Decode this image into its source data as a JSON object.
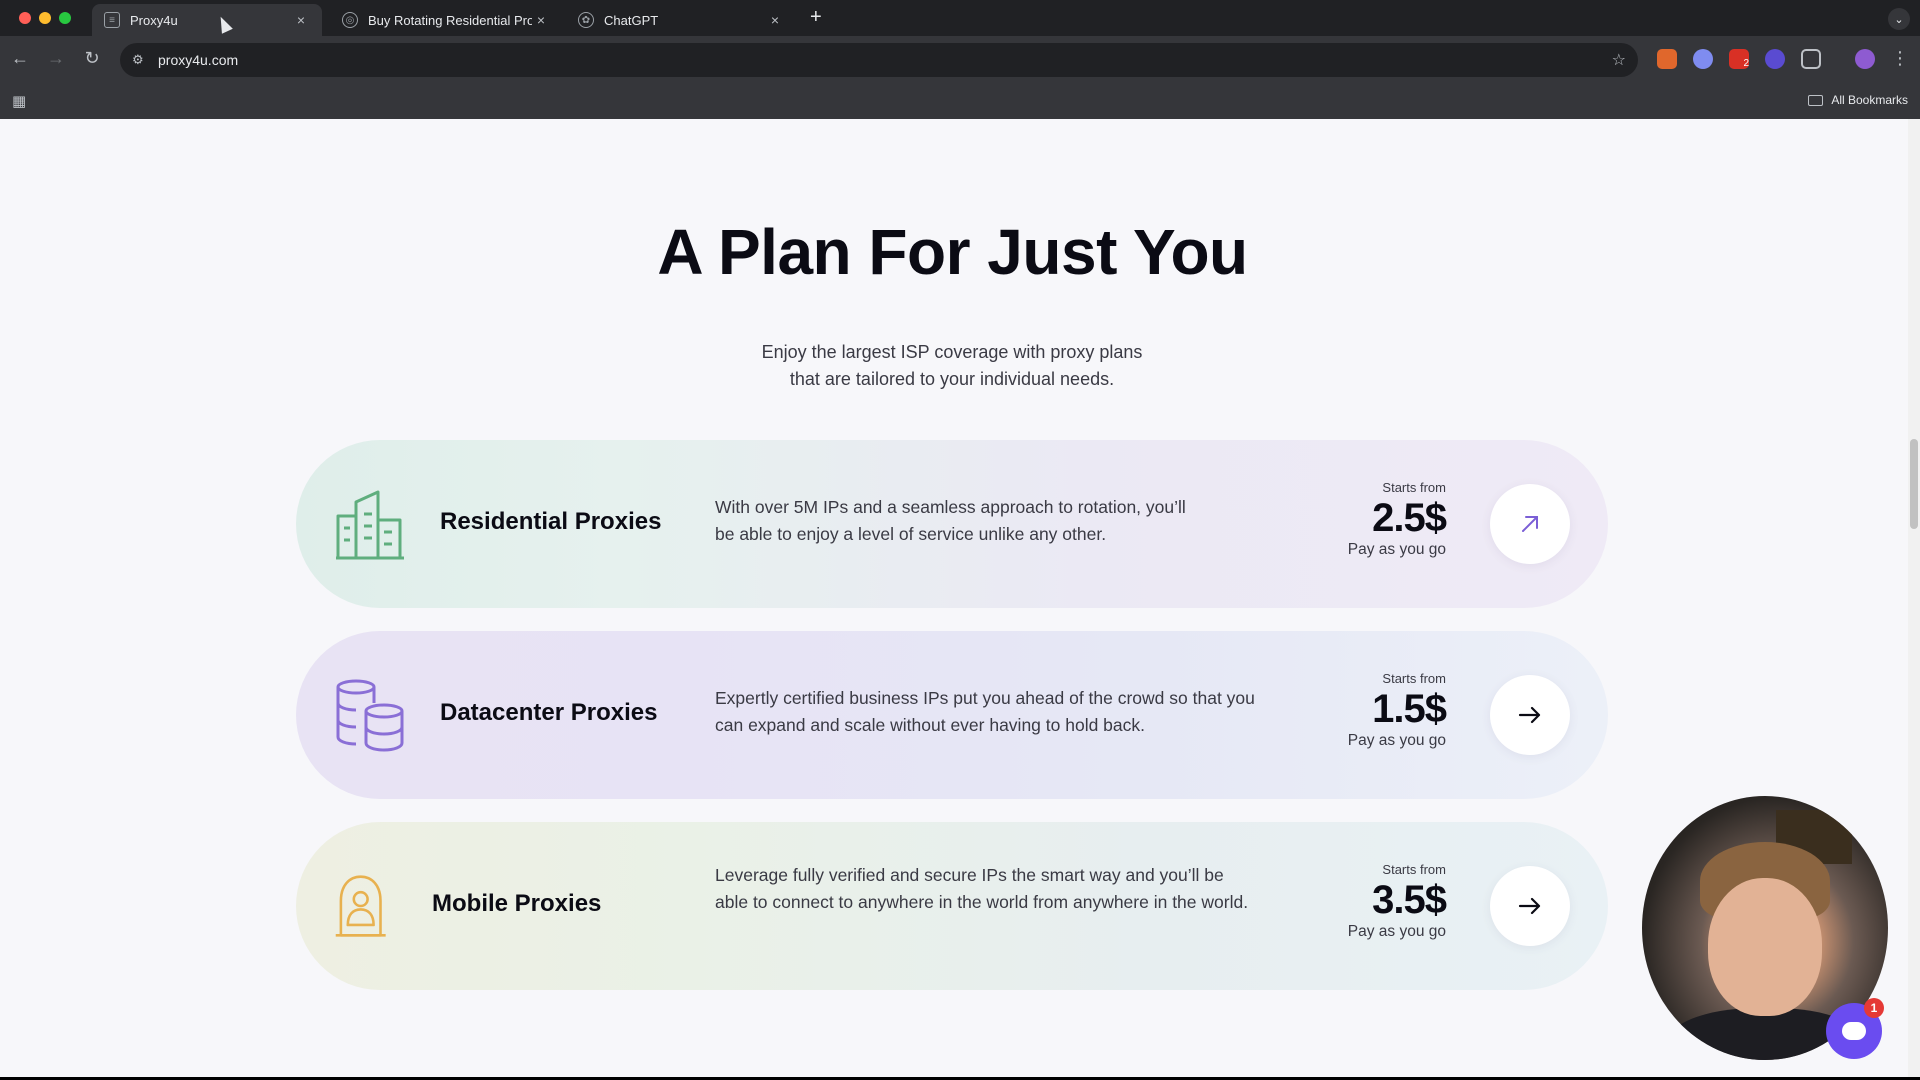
{
  "browser": {
    "tabs": [
      {
        "title": "Proxy4u",
        "active": true,
        "favicon": "proxy4u-favicon"
      },
      {
        "title": "Buy Rotating Residential Pro",
        "active": false,
        "favicon": "spiral-favicon"
      },
      {
        "title": "ChatGPT",
        "active": false,
        "favicon": "chatgpt-favicon"
      }
    ],
    "new_tab": "+",
    "close": "×",
    "url": "proxy4u.com",
    "bookmarks_label": "All Bookmarks",
    "extension_badge": "2"
  },
  "page": {
    "heading": "A Plan For Just You",
    "subtitle_line1": "Enjoy the largest ISP coverage with proxy plans",
    "subtitle_line2": "that are tailored to your individual needs.",
    "plans": [
      {
        "name": "Residential Proxies",
        "icon": "building-icon",
        "description": "With over 5M IPs and a seamless approach to rotation, you’ll be able to enjoy a level of service unlike any other.",
        "starts_from": "Starts from",
        "price": "2.5$",
        "billing": "Pay as you go",
        "arrow": "↗"
      },
      {
        "name": "Datacenter Proxies",
        "icon": "database-icon",
        "description": "Expertly certified business IPs put you ahead of the crowd so that you can expand and scale without ever having to hold back.",
        "starts_from": "Starts from",
        "price": "1.5$",
        "billing": "Pay as you go",
        "arrow": "→"
      },
      {
        "name": "Mobile Proxies",
        "icon": "mobile-lock-icon",
        "description": "Leverage fully verified and secure IPs the smart way and you’ll be able to connect to anywhere in the world from anywhere in the world.",
        "starts_from": "Starts from",
        "price": "3.5$",
        "billing": "Pay as you go",
        "arrow": "→"
      }
    ]
  },
  "chat_widget": {
    "badge": "1"
  },
  "colors": {
    "chrome_dark": "#202124",
    "chrome_toolbar": "#35363a",
    "page_bg": "#f7f7fa",
    "text_dark": "#0b0b14",
    "residential_icon": "#5fae7e",
    "datacenter_icon": "#8a6fd6",
    "mobile_icon": "#e8b14f",
    "chat_accent": "#6a4cf0"
  }
}
